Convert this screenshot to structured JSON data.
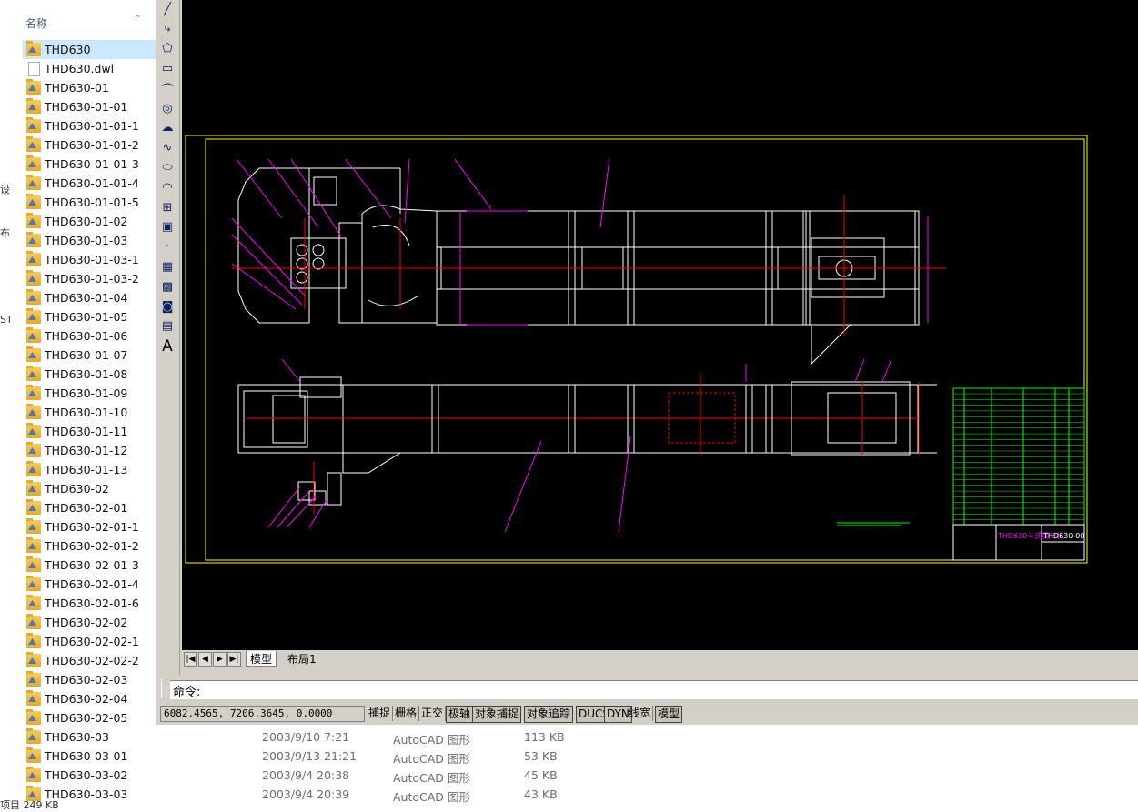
{
  "explorer": {
    "column_name": "名称",
    "files": [
      {
        "name": "THD630",
        "type": "folder",
        "selected": true
      },
      {
        "name": "THD630.dwl",
        "type": "doc"
      },
      {
        "name": "THD630-01",
        "type": "folder"
      },
      {
        "name": "THD630-01-01",
        "type": "folder"
      },
      {
        "name": "THD630-01-01-1",
        "type": "folder"
      },
      {
        "name": "THD630-01-01-2",
        "type": "folder"
      },
      {
        "name": "THD630-01-01-3",
        "type": "folder"
      },
      {
        "name": "THD630-01-01-4",
        "type": "folder"
      },
      {
        "name": "THD630-01-01-5",
        "type": "folder"
      },
      {
        "name": "THD630-01-02",
        "type": "folder"
      },
      {
        "name": "THD630-01-03",
        "type": "folder"
      },
      {
        "name": "THD630-01-03-1",
        "type": "folder"
      },
      {
        "name": "THD630-01-03-2",
        "type": "folder"
      },
      {
        "name": "THD630-01-04",
        "type": "folder"
      },
      {
        "name": "THD630-01-05",
        "type": "folder"
      },
      {
        "name": "THD630-01-06",
        "type": "folder"
      },
      {
        "name": "THD630-01-07",
        "type": "folder"
      },
      {
        "name": "THD630-01-08",
        "type": "folder"
      },
      {
        "name": "THD630-01-09",
        "type": "folder"
      },
      {
        "name": "THD630-01-10",
        "type": "folder"
      },
      {
        "name": "THD630-01-11",
        "type": "folder"
      },
      {
        "name": "THD630-01-12",
        "type": "folder"
      },
      {
        "name": "THD630-01-13",
        "type": "folder"
      },
      {
        "name": "THD630-02",
        "type": "folder"
      },
      {
        "name": "THD630-02-01",
        "type": "folder"
      },
      {
        "name": "THD630-02-01-1",
        "type": "folder"
      },
      {
        "name": "THD630-02-01-2",
        "type": "folder"
      },
      {
        "name": "THD630-02-01-3",
        "type": "folder"
      },
      {
        "name": "THD630-02-01-4",
        "type": "folder"
      },
      {
        "name": "THD630-02-01-6",
        "type": "folder"
      },
      {
        "name": "THD630-02-02",
        "type": "folder"
      },
      {
        "name": "THD630-02-02-1",
        "type": "folder"
      },
      {
        "name": "THD630-02-02-2",
        "type": "folder"
      },
      {
        "name": "THD630-02-03",
        "type": "folder"
      },
      {
        "name": "THD630-02-04",
        "type": "folder"
      },
      {
        "name": "THD630-02-05",
        "type": "folder"
      },
      {
        "name": "THD630-03",
        "type": "folder"
      },
      {
        "name": "THD630-03-01",
        "type": "folder"
      },
      {
        "name": "THD630-03-02",
        "type": "folder"
      },
      {
        "name": "THD630-03-03",
        "type": "folder"
      }
    ],
    "details": [
      {
        "date": "2003/9/10 7:21",
        "type": "AutoCAD 图形",
        "size": "113 KB"
      },
      {
        "date": "2003/9/13 21:21",
        "type": "AutoCAD 图形",
        "size": "53 KB"
      },
      {
        "date": "2003/9/4 20:38",
        "type": "AutoCAD 图形",
        "size": "45 KB"
      },
      {
        "date": "2003/9/4 20:39",
        "type": "AutoCAD 图形",
        "size": "43 KB"
      }
    ],
    "left_strip_chars": [
      "设",
      "布",
      "ST"
    ],
    "status_text": "项目 249 KB"
  },
  "acad": {
    "tools": [
      "line-icon",
      "polyline-icon",
      "polygon-icon",
      "rectangle-icon",
      "arc-icon",
      "circle-icon",
      "revision-cloud-icon",
      "spline-icon",
      "ellipse-icon",
      "ellipse-arc-icon",
      "insert-block-icon",
      "make-block-icon",
      "point-icon",
      "hatch-icon",
      "gradient-icon",
      "region-icon",
      "table-icon",
      "text-icon"
    ],
    "text_tool_label": "A",
    "tabs": {
      "model": "模型",
      "layout1": "布局1"
    },
    "command_prompt": "命令:",
    "coordinates": "6082.4565, 7206.3645, 0.0000",
    "status_buttons": [
      "捕捉",
      "栅格",
      "正交",
      "极轴",
      "对象捕捉",
      "对象追踪",
      "DUCS",
      "DYN",
      "线宽",
      "模型"
    ],
    "status_buttons_on": [
      "极轴",
      "对象捕捉",
      "对象追踪",
      "DUCS",
      "DYN",
      "模型"
    ],
    "title_block": {
      "drawing_number": "THD630-00",
      "title": "THD630斗式提升机"
    },
    "colors": {
      "background": "#000000",
      "frame": "#ffff00",
      "outline": "#ffffff",
      "centerline": "#ff0000",
      "leader": "#ff00ff",
      "table": "#00ff00"
    }
  }
}
